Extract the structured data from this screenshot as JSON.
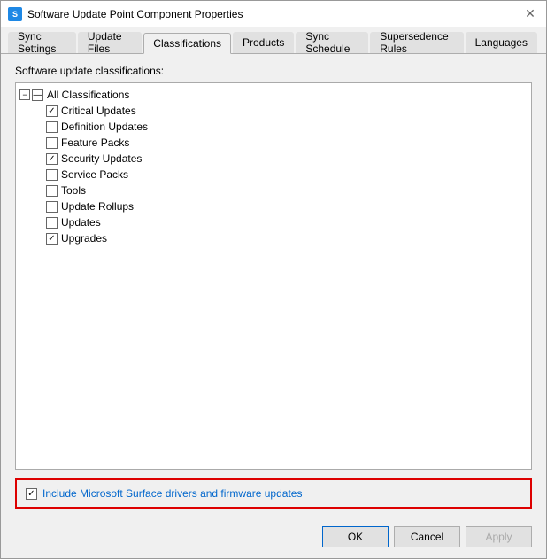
{
  "window": {
    "title": "Software Update Point Component Properties",
    "icon": "S"
  },
  "tabs": [
    {
      "id": "sync-settings",
      "label": "Sync Settings",
      "active": false
    },
    {
      "id": "update-files",
      "label": "Update Files",
      "active": false
    },
    {
      "id": "classifications",
      "label": "Classifications",
      "active": true
    },
    {
      "id": "products",
      "label": "Products",
      "active": false
    },
    {
      "id": "sync-schedule",
      "label": "Sync Schedule",
      "active": false
    },
    {
      "id": "supersedence-rules",
      "label": "Supersedence Rules",
      "active": false
    },
    {
      "id": "languages",
      "label": "Languages",
      "active": false
    }
  ],
  "section_label": "Software update classifications:",
  "tree": {
    "root": {
      "label": "All Classifications",
      "checked": "partial",
      "expanded": true
    },
    "items": [
      {
        "label": "Critical Updates",
        "checked": true
      },
      {
        "label": "Definition Updates",
        "checked": false
      },
      {
        "label": "Feature Packs",
        "checked": false
      },
      {
        "label": "Security Updates",
        "checked": true
      },
      {
        "label": "Service Packs",
        "checked": false
      },
      {
        "label": "Tools",
        "checked": false
      },
      {
        "label": "Update Rollups",
        "checked": false
      },
      {
        "label": "Updates",
        "checked": false
      },
      {
        "label": "Upgrades",
        "checked": true
      }
    ]
  },
  "surface": {
    "label_prefix": "Include Microsoft Surface drivers",
    "label_link": " and firmware updates",
    "checked": true
  },
  "buttons": {
    "ok": "OK",
    "cancel": "Cancel",
    "apply": "Apply"
  }
}
